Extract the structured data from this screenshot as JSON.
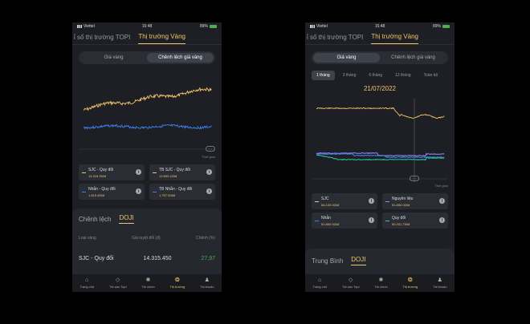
{
  "status": {
    "carrier": "Viettel",
    "time": "15:48",
    "battery": "89%"
  },
  "colors": {
    "gold": "#f2c46d",
    "blue": "#3b82f6",
    "purple": "#9b87f5",
    "green": "#2ec4a0"
  },
  "screen1": {
    "top_tabs": [
      "ỉ số thị trường TOPI",
      "Thị trường Vàng"
    ],
    "seg": [
      "Giá vàng",
      "Chênh lệch giá vàng"
    ],
    "x_label": "Thời gian",
    "handle": "‹ ›",
    "legend": [
      {
        "name": "SJC - Quy đổi",
        "value": "14.315.353đ"
      },
      {
        "name": "TB SJC - Quy đổi",
        "value": "13.852.425đ"
      },
      {
        "name": "Nhẫn - Quy đổi",
        "value": "1.815.450đ"
      },
      {
        "name": "TB Nhẫn - Quy đổi",
        "value": "1.757.926đ"
      }
    ],
    "panel_tabs": [
      "Chênh lệch",
      "DOJI"
    ],
    "table_headers": [
      "Loại vàng",
      "Giá tuyệt đối (đ)",
      "Chênh (%)"
    ],
    "row": {
      "name": "SJC - Quy đổi",
      "value": "14.315.450",
      "pct": "27,97"
    }
  },
  "screen2": {
    "top_tabs": [
      "ỉ số thị trường TOPI",
      "Thị trường Vàng"
    ],
    "seg": [
      "Giá vàng",
      "Chênh lệch giá vàng"
    ],
    "periods": [
      "1 tháng",
      "3 tháng",
      "6 tháng",
      "12 tháng",
      "Toàn bộ"
    ],
    "date": "21/07/2022",
    "x_label": "Thời gian",
    "handle": "‹ ›",
    "legend": [
      {
        "name": "SJC",
        "value": "66.100.000đ"
      },
      {
        "name": "Nguyên liệu",
        "value": "51.650.000đ"
      },
      {
        "name": "Nhẫn",
        "value": "51.850.000đ"
      },
      {
        "name": "Quy đổi",
        "value": "50.201.750đ"
      }
    ],
    "panel_tabs": [
      "Trung Bình",
      "DOJI"
    ]
  },
  "nav": [
    "Trang chủ",
    "Tài sản Topi",
    "Tài chính",
    "Thị trường",
    "Tài khoản"
  ]
}
